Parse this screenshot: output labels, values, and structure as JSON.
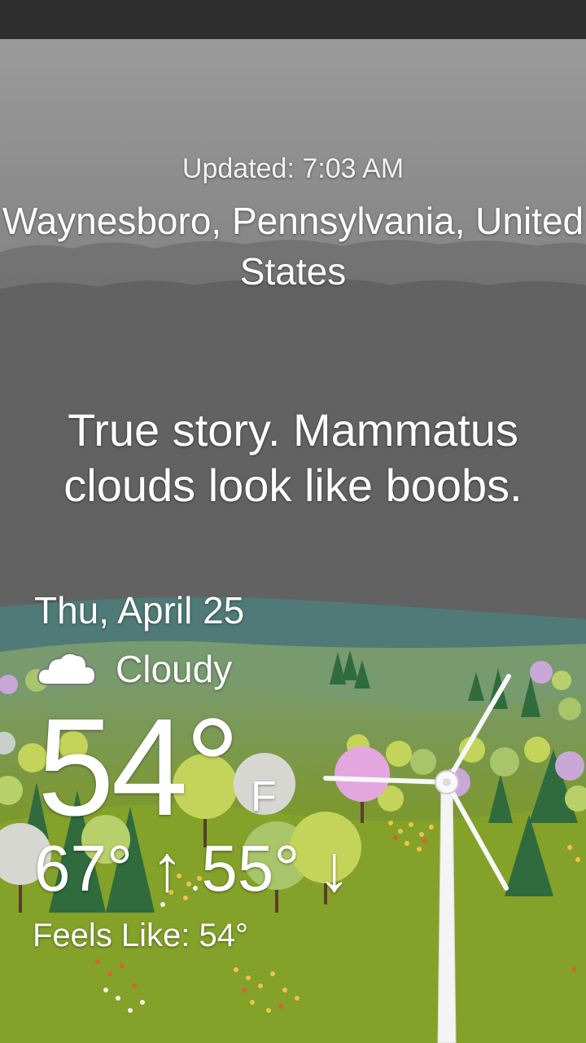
{
  "header": {
    "updated": "Updated: 7:03 AM",
    "location": "Waynesboro, Pennsylvania, United States"
  },
  "quote": "True story. Mammatus clouds look like boobs.",
  "forecast": {
    "date": "Thu, April 25",
    "condition_icon": "cloud-icon",
    "condition": "Cloudy",
    "temperature": "54°",
    "unit": "F",
    "high_low": "67° ↑ 55° ↓",
    "feels_like": "Feels Like: 54°"
  },
  "colors": {
    "sky_top": "#8f8f8f",
    "sky_bottom": "#585858",
    "river": "#4f7a77",
    "grass": "#7f9a2e",
    "text": "#ffffff"
  }
}
